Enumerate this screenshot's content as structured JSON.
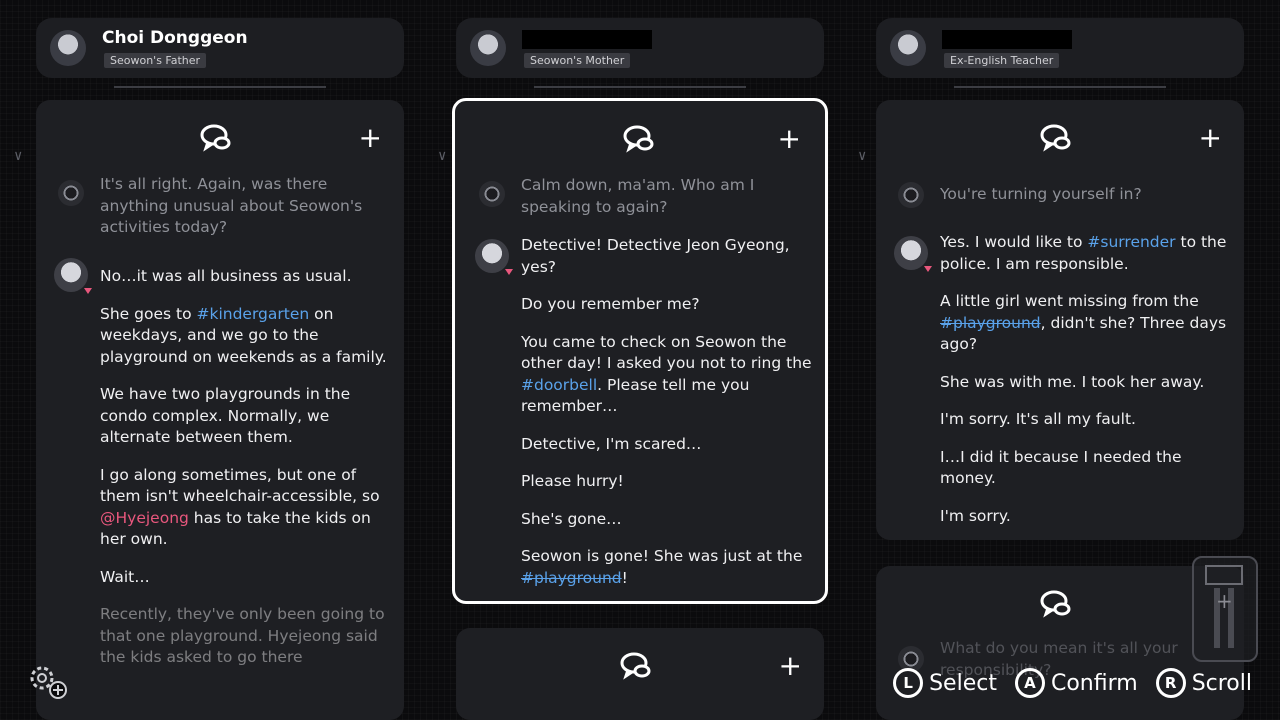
{
  "columns": [
    {
      "header": {
        "name": "Choi Donggeon",
        "role": "Seowon's Father",
        "redacted": false
      },
      "card": {
        "messages": [
          {
            "speaker": "officer",
            "paragraphs": [
              "It's all right. Again, was there anything unusual about Seowon's activities today?"
            ]
          },
          {
            "speaker": "person",
            "paragraphs": [
              "No…it was all business as usual.",
              "She goes to #kindergarten on weekdays, and we go to the playground on weekends as a family.",
              "We have two playgrounds in the condo complex. Normally, we alternate between them.",
              "I go along sometimes, but one of them isn't wheelchair-accessible, so @Hyejeong has to take the kids on her own.",
              "Wait…",
              "Recently, they've only been going to that one playground. Hyejeong said the kids asked to go there"
            ]
          }
        ]
      }
    },
    {
      "header": {
        "name": "",
        "role": "Seowon's Mother",
        "redacted": true
      },
      "card": {
        "messages": [
          {
            "speaker": "officer",
            "paragraphs": [
              "Calm down, ma'am. Who am I speaking to again?"
            ]
          },
          {
            "speaker": "person",
            "paragraphs": [
              "Detective! Detective Jeon Gyeong, yes?",
              "Do you remember me?",
              "You came to check on Seowon the other day! I asked you not to ring the #doorbell. Please tell me you remember…",
              "Detective, I'm scared…",
              "Please hurry!",
              "She's gone…",
              "Seowon is gone! She was just at the #playground!"
            ]
          }
        ]
      }
    },
    {
      "header": {
        "name": "",
        "role": "Ex-English Teacher",
        "redacted": true
      },
      "card": {
        "messages": [
          {
            "speaker": "officer",
            "paragraphs": [
              "You're turning yourself in?"
            ]
          },
          {
            "speaker": "person",
            "paragraphs": [
              "Yes. I would like to #surrender to the police. I am responsible.",
              "A little girl went missing from the #playground, didn't she? Three days ago?",
              "She was with me. I took her away.",
              "I'm sorry. It's all my fault.",
              "I…I did it because I needed the money.",
              "I'm sorry."
            ]
          }
        ]
      },
      "card2": {
        "messages": [
          {
            "speaker": "officer",
            "paragraphs": [
              "What do you mean it's all your responsibility?"
            ]
          }
        ]
      }
    }
  ],
  "controls": {
    "select": {
      "glyph": "L",
      "label": "Select"
    },
    "confirm": {
      "glyph": "A",
      "label": "Confirm"
    },
    "scroll": {
      "glyph": "R",
      "label": "Scroll"
    }
  },
  "icons": {
    "chat": "chat-bubbles-icon",
    "add": "plus-icon",
    "settings": "gear-plus-icon",
    "officer": "police-badge-icon"
  },
  "colors": {
    "hashtag": "#5aa2ea",
    "mention": "#e8577d",
    "panel": "#1e1f23",
    "background": "#0b0b0d"
  }
}
